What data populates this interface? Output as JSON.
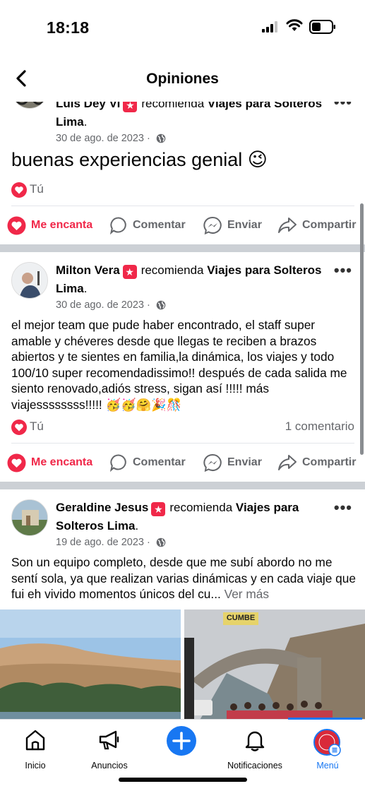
{
  "status_bar": {
    "time": "18:18"
  },
  "header": {
    "title": "Opiniones"
  },
  "posts": [
    {
      "author": "Luis Dey Vi",
      "recommends": "recomienda",
      "page": "Viajes para Solteros Lima",
      "date": "30 de ago. de 2023",
      "dot": "·",
      "text": "buenas experiencias genial 😉",
      "reaction_label": "Tú",
      "comments": ""
    },
    {
      "author": "Milton Vera",
      "recommends": "recomienda",
      "page": "Viajes para Solteros Lima",
      "date": "30 de ago. de 2023",
      "dot": "·",
      "text": "el mejor team que pude haber encontrado, el staff super amable y chéveres desde que llegas te reciben a brazos abiertos y te sientes en familia,la dinámica, los viajes y todo 100/10 super recomendadissimo!! después de cada salida me siento renovado,adiós stress, sigan así !!!!! más viajessssssss!!!!! 🥳🥳🤗🎉🎊",
      "reaction_label": "Tú",
      "comments": "1 comentario"
    },
    {
      "author": "Geraldine Jesus",
      "recommends": "recomienda",
      "page": "Viajes para Solteros Lima",
      "date": "19 de ago. de 2023",
      "dot": "·",
      "text": "Son un equipo completo, desde que me subí abordo no me sentí sola, ya que realizan varias dinámicas y en cada viaje que fui eh vivido momentos únicos del cu...",
      "see_more": "Ver más",
      "photo_sign": "CUMBE"
    }
  ],
  "actions": {
    "love": "Me encanta",
    "comment": "Comentar",
    "send": "Enviar",
    "share": "Compartir"
  },
  "nav": {
    "home": "Inicio",
    "ads": "Anuncios",
    "notifications": "Notificaciones",
    "menu": "Menú"
  },
  "colors": {
    "accent": "#1877f2",
    "love": "#f02849",
    "secondary_text": "#65676b",
    "separator": "#ccd0d5"
  }
}
